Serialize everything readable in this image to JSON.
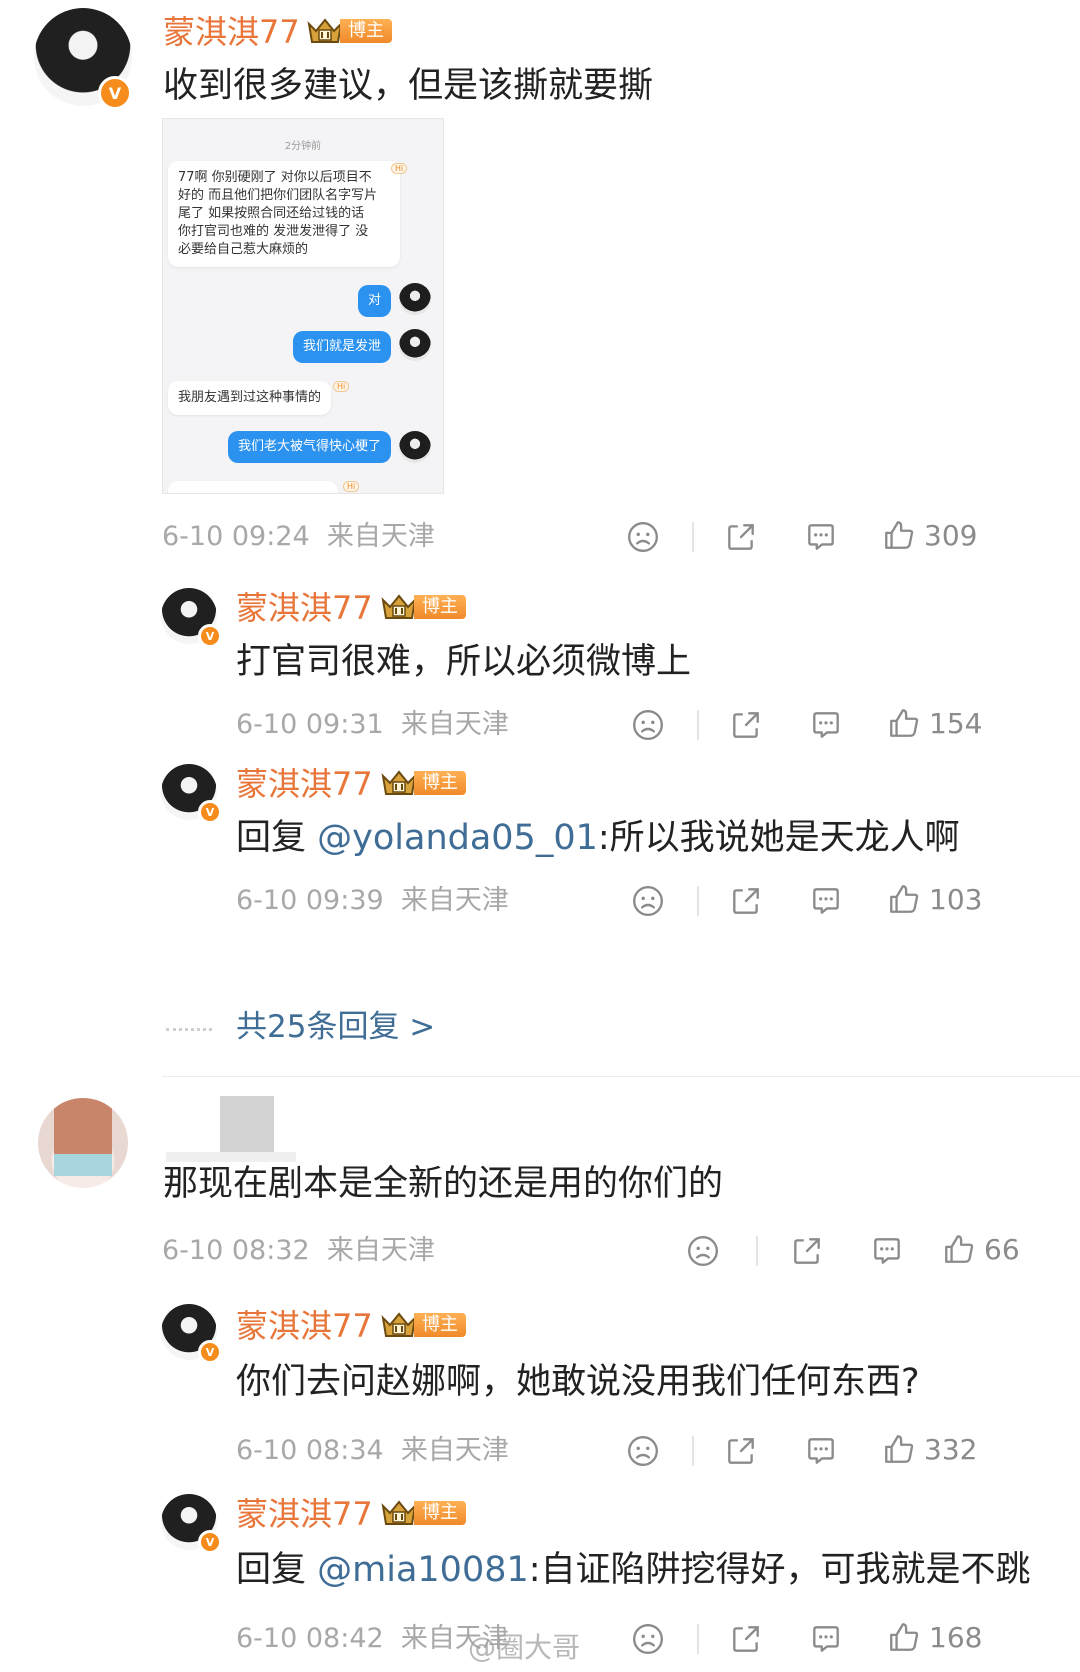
{
  "colors": {
    "username": "#e8763a",
    "mention": "#3f6d96",
    "meta": "#a8a8a8",
    "badge": "#f08a2a"
  },
  "post": {
    "author": "蒙淇淇77",
    "badge": "博主",
    "text": "收到很多建议，但是该撕就要撕",
    "time": "6-10 09:24",
    "location": "来自天津",
    "likes": "309",
    "screenshot": {
      "timestamp": "2分钟前",
      "msg1": [
        "77啊 你别硬刚了 对你以后项目不",
        "好的 而且他们把你们团队名字写片",
        "尾了 如果按照合同还给过钱的话",
        "你打官司也难的 发泄发泄得了 没",
        "必要给自己惹大麻烦的"
      ],
      "reply1": "对",
      "reply2": "我们就是发泄",
      "msg2": "我朋友遇到过这种事情的",
      "reply3": "我们老大被气得快心梗了",
      "hi_tag": "Hi"
    }
  },
  "replies_a": [
    {
      "author": "蒙淇淇77",
      "badge": "博主",
      "prefix": "",
      "mention": "",
      "text": "打官司很难，所以必须微博上",
      "time": "6-10 09:31",
      "location": "来自天津",
      "likes": "154"
    },
    {
      "author": "蒙淇淇77",
      "badge": "博主",
      "prefix": "回复 ",
      "mention": "@yolanda05_01",
      "text": ":所以我说她是天龙人啊",
      "time": "6-10 09:39",
      "location": "来自天津",
      "likes": "103"
    }
  ],
  "more_replies": "共25条回复 >",
  "comment2": {
    "text": "那现在剧本是全新的还是用的你们的",
    "time": "6-10 08:32",
    "location": "来自天津",
    "likes": "66"
  },
  "replies_b": [
    {
      "author": "蒙淇淇77",
      "badge": "博主",
      "prefix": "",
      "mention": "",
      "text": "你们去问赵娜啊，她敢说没用我们任何东西?",
      "time": "6-10 08:34",
      "location": "来自天津",
      "likes": "332"
    },
    {
      "author": "蒙淇淇77",
      "badge": "博主",
      "prefix": "回复 ",
      "mention": "@mia10081",
      "text": ":自证陷阱挖得好，可我就是不跳",
      "time": "6-10 08:42",
      "location": "来自天津",
      "likes": "168"
    }
  ],
  "watermark": "@圈大哥",
  "icons": {
    "dislike": "sad-face-icon",
    "share": "share-icon",
    "comment": "comment-icon",
    "like": "thumbs-up-icon",
    "verified": "verified-icon",
    "crown": "crown-icon"
  }
}
